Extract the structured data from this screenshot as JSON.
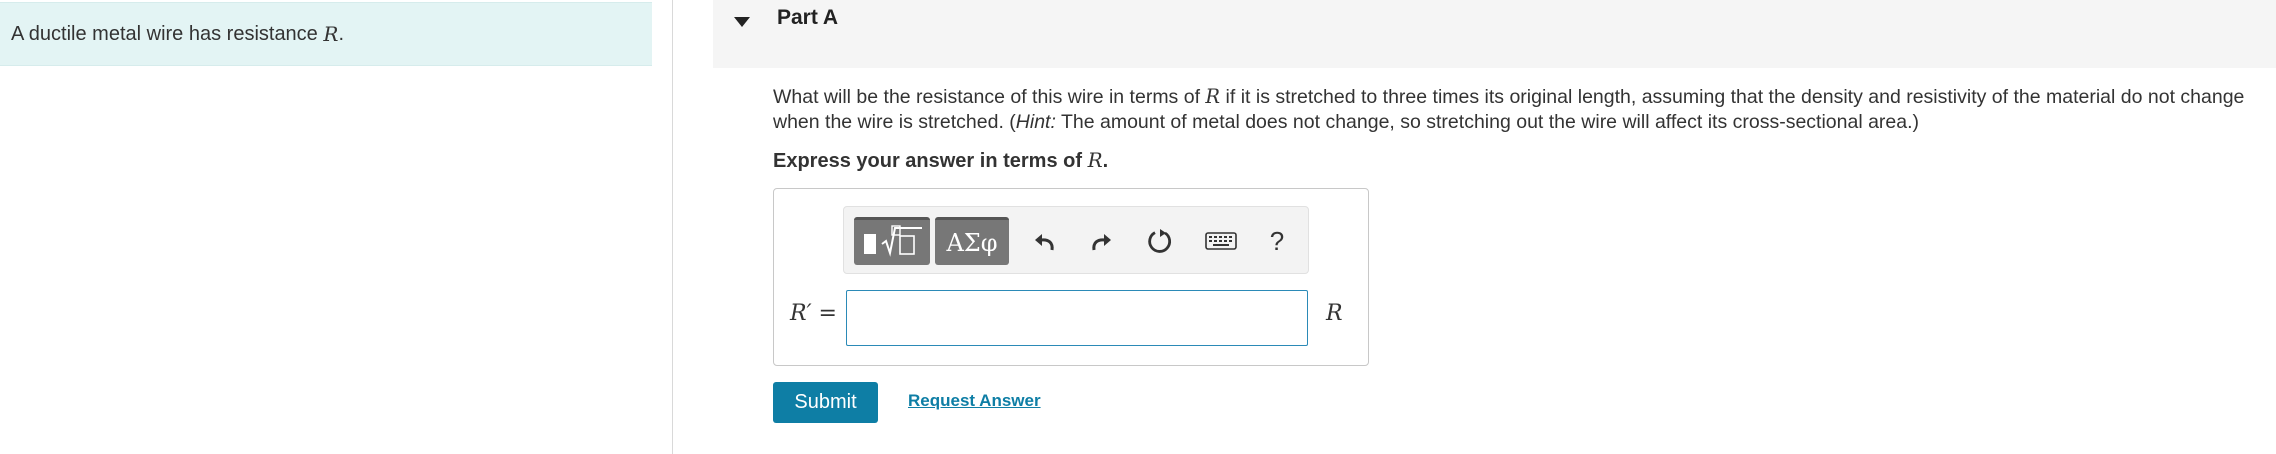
{
  "intro": {
    "text": "A ductile metal wire has resistance ",
    "var": "R",
    "tail": "."
  },
  "part": {
    "title": "Part A"
  },
  "question": {
    "l1_a": "What will be the resistance of this wire in terms of ",
    "l1_var": "R",
    "l1_b": " if it is stretched to three times its original length, assuming that the density and resistivity of the material do not change",
    "l2_a": "when the wire is stretched. (",
    "l2_hint": "Hint:",
    "l2_b": " The amount of metal does not change, so stretching out the wire will affect its cross-sectional area.)"
  },
  "express": {
    "text": "Express your answer in terms of ",
    "var": "R",
    "tail": "."
  },
  "toolbar": {
    "greek_label": "ΑΣφ",
    "help_label": "?",
    "icons": [
      "templates-icon",
      "greek-symbols-icon",
      "undo-icon",
      "redo-icon",
      "reset-icon",
      "keyboard-icon",
      "help-icon"
    ]
  },
  "answer": {
    "variable_label": "R′ =",
    "value": "",
    "unit": "R"
  },
  "actions": {
    "submit_label": "Submit",
    "request_label": "Request Answer"
  },
  "colors": {
    "intro_bg": "#e3f4f4",
    "accent": "#0e7ea5",
    "input_border": "#2b8ab7",
    "header_bg": "#f5f5f5"
  }
}
